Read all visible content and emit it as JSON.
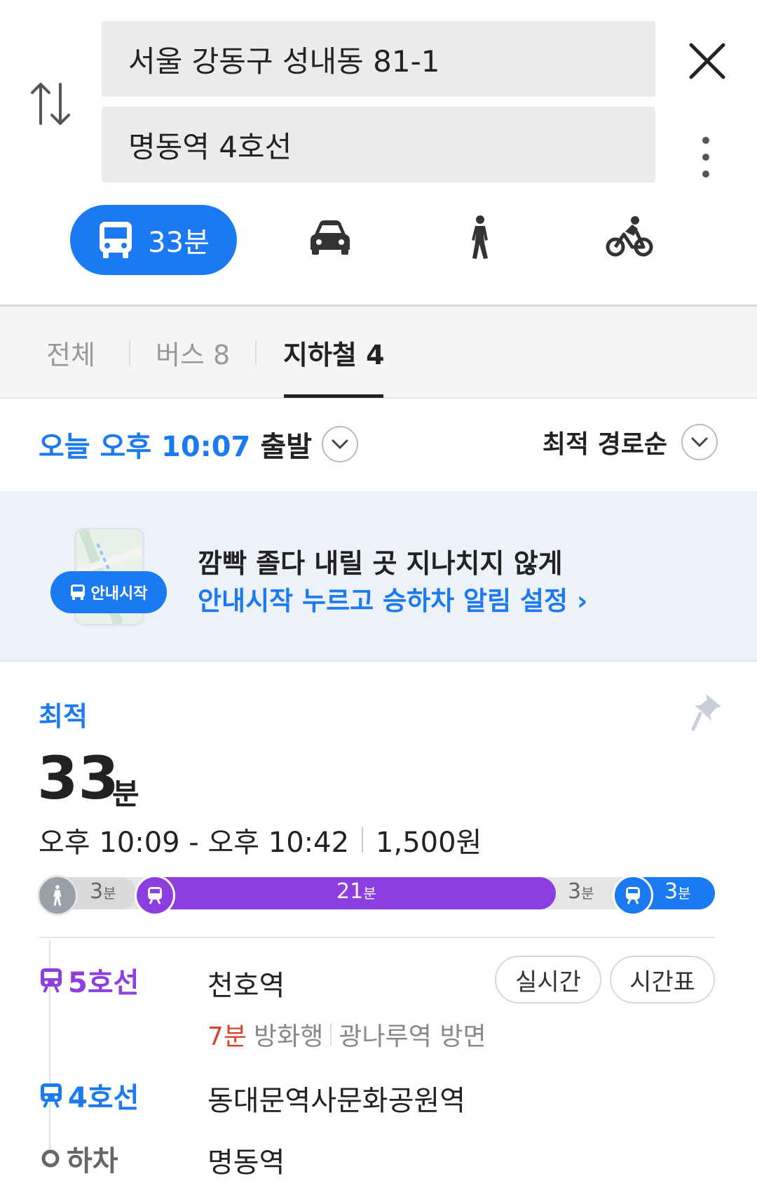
{
  "search": {
    "origin": "서울 강동구 성내동 81-1",
    "destination": "명동역 4호선"
  },
  "modes": {
    "transit_time": "33분"
  },
  "tabs": [
    {
      "label": "전체"
    },
    {
      "label": "버스 8"
    },
    {
      "label": "지하철 4"
    }
  ],
  "departure": {
    "time": "오늘 오후 10:07",
    "action": "출발",
    "sort": "최적 경로순"
  },
  "banner": {
    "title": "깜빡 졸다 내릴 곳 지나치지 않게",
    "subtitle": "안내시작 누르고 승하차 알림 설정",
    "pill": "안내시작"
  },
  "route": {
    "badge": "최적",
    "duration_num": "33",
    "duration_unit": "분",
    "time_range": "오후 10:09 - 오후 10:42",
    "fare": "1,500원",
    "segments": {
      "walk1": "3",
      "subway": "21",
      "walk2": "3",
      "bus": "3",
      "unit": "분"
    },
    "segment_fractions": {
      "walk1": 0.09,
      "subway": 0.64,
      "walk2": 0.09,
      "bus": 0.09
    },
    "steps": {
      "line5": "5호선",
      "station5": "천호역",
      "realtime": "실시간",
      "timetable": "시간표",
      "wait": "7분",
      "direction": "방화행",
      "platform": "광나루역 방면",
      "line4": "4호선",
      "station4": "동대문역사문화공원역",
      "alight": "하차",
      "alight_station": "명동역"
    }
  },
  "colors": {
    "accent": "#1b79f2",
    "line5": "#8c3ee0",
    "line4": "#1b79f2",
    "wait": "#d9452c"
  }
}
